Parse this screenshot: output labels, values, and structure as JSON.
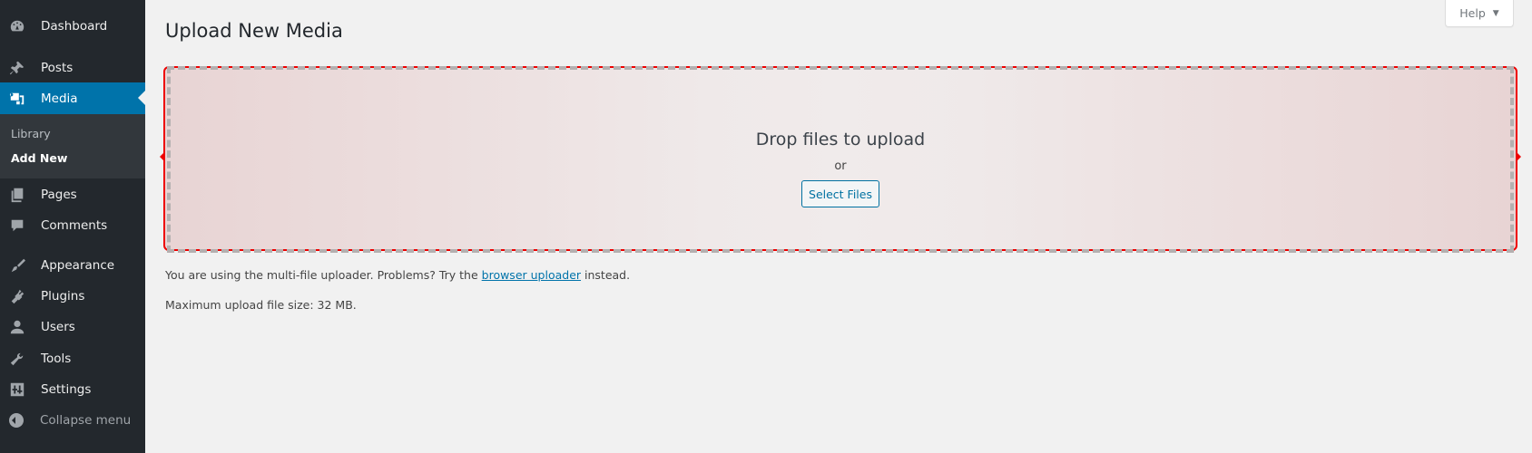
{
  "sidebar": {
    "items": [
      {
        "label": "Dashboard",
        "icon": "dashboard-icon"
      },
      {
        "label": "Posts",
        "icon": "pin-icon"
      },
      {
        "label": "Media",
        "icon": "media-icon",
        "current": true
      },
      {
        "label": "Pages",
        "icon": "pages-icon"
      },
      {
        "label": "Comments",
        "icon": "comment-icon"
      },
      {
        "label": "Appearance",
        "icon": "paintbrush-icon"
      },
      {
        "label": "Plugins",
        "icon": "plugin-icon"
      },
      {
        "label": "Users",
        "icon": "user-icon"
      },
      {
        "label": "Tools",
        "icon": "wrench-icon"
      },
      {
        "label": "Settings",
        "icon": "settings-icon"
      }
    ],
    "submenu": [
      {
        "label": "Library"
      },
      {
        "label": "Add New",
        "active": true
      }
    ],
    "collapse_label": "Collapse menu"
  },
  "header": {
    "help_label": "Help",
    "page_title": "Upload New Media"
  },
  "uploader": {
    "drop_title": "Drop files to upload",
    "or_label": "or",
    "select_files_label": "Select Files"
  },
  "info": {
    "multi_prefix": "You are using the multi-file uploader. Problems? Try the",
    "browser_uploader_link": "browser uploader",
    "multi_suffix": "instead.",
    "max_size": "Maximum upload file size: 32 MB."
  },
  "colors": {
    "sidebar_bg": "#23282d",
    "accent": "#0073aa",
    "drop_border": "#ee0000"
  }
}
